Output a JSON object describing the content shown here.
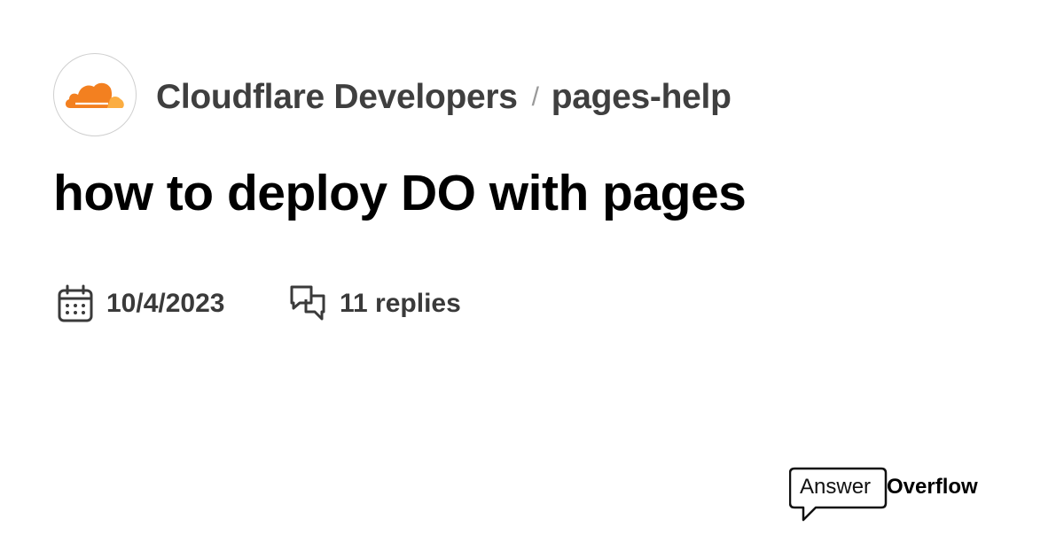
{
  "server": {
    "name": "Cloudflare Developers",
    "avatar_icon": "cloudflare-cloud-logo",
    "avatar_color": "#F38020"
  },
  "breadcrumb": {
    "separator": "/",
    "channel": "pages-help"
  },
  "thread": {
    "title": "how to deploy DO with pages",
    "date": "10/4/2023",
    "replies": "11 replies"
  },
  "icons": {
    "date": "calendar-icon",
    "replies": "chat-bubbles-icon"
  },
  "brand": {
    "part1": "Answer",
    "part2": "Overflow"
  }
}
